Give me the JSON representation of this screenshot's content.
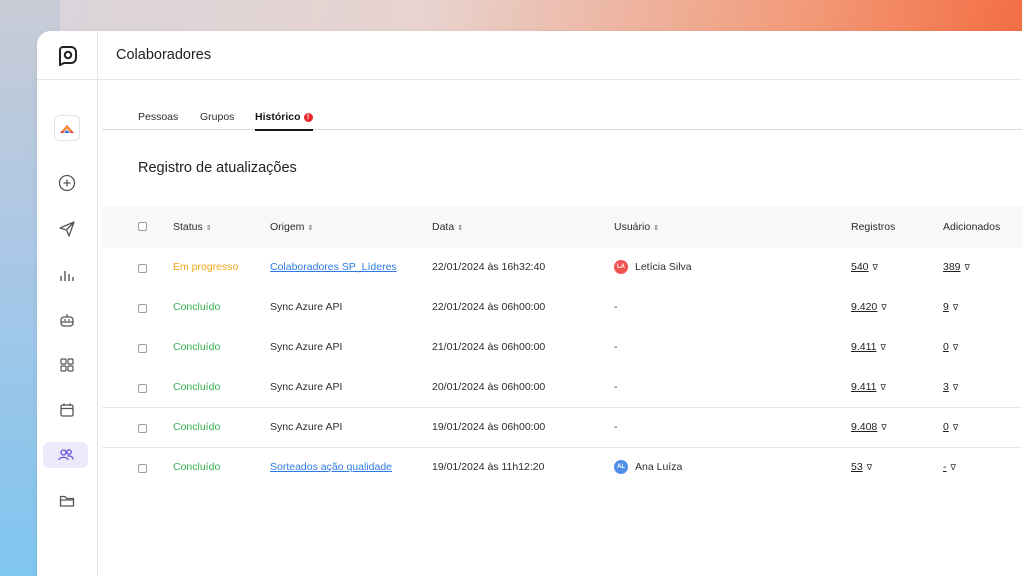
{
  "app": {
    "title": "Colaboradores"
  },
  "sidebar": {
    "org_avatar": "org-logo",
    "items": [
      {
        "name": "add-icon"
      },
      {
        "name": "send-icon"
      },
      {
        "name": "chart-icon"
      },
      {
        "name": "bot-icon"
      },
      {
        "name": "grid-icon"
      },
      {
        "name": "calendar-icon"
      },
      {
        "name": "people-icon",
        "active": true
      },
      {
        "name": "folder-icon"
      }
    ]
  },
  "tabs": [
    {
      "label": "Pessoas"
    },
    {
      "label": "Grupos"
    },
    {
      "label": "Histórico",
      "active": true,
      "badge": "!"
    }
  ],
  "section_title": "Registro de atualizações",
  "table": {
    "columns": {
      "status": "Status",
      "origem": "Origem",
      "data": "Data",
      "usuario": "Usuário",
      "registros": "Registros",
      "adicionados": "Adicionados"
    },
    "sort_glyph": "⇕",
    "filter_glyph": "∇",
    "rows": [
      {
        "status": "Em progresso",
        "origem": "Colaboradores SP_Líderes",
        "data": "22/01/2024 às 16h32:40",
        "usuario": "Letícia Silva",
        "usuario_initials": "LA",
        "registros": "540",
        "adicionados": "389"
      },
      {
        "status": "Concluído",
        "origem": "Sync Azure API",
        "data": "22/01/2024 às 06h00:00",
        "usuario": "-",
        "registros": "9.420",
        "adicionados": "9"
      },
      {
        "status": "Concluído",
        "origem": "Sync Azure API",
        "data": "21/01/2024 às 06h00:00",
        "usuario": "-",
        "registros": "9.411",
        "adicionados": "0"
      },
      {
        "status": "Concluído",
        "origem": "Sync Azure API",
        "data": "20/01/2024 às 06h00:00",
        "usuario": "-",
        "registros": "9.411",
        "adicionados": "3"
      },
      {
        "status": "Concluído",
        "origem": "Sync Azure API",
        "data": "19/01/2024 às 06h00:00",
        "usuario": "-",
        "registros": "9.408",
        "adicionados": "0"
      },
      {
        "status": "Concluído",
        "origem": "Sorteados ação qualidade",
        "data": "19/01/2024 às 11h12:20",
        "usuario": "Ana Luíza",
        "usuario_initials": "AL",
        "registros": "53",
        "adicionados": "-"
      }
    ]
  },
  "colors": {
    "status_progress": "#f2a516",
    "status_done": "#33b24d",
    "link": "#2c7be5",
    "accent_active": "#ece9fb",
    "badge": "#e8262a",
    "avatar_la": "#ef5350",
    "avatar_al": "#4f8de8"
  }
}
